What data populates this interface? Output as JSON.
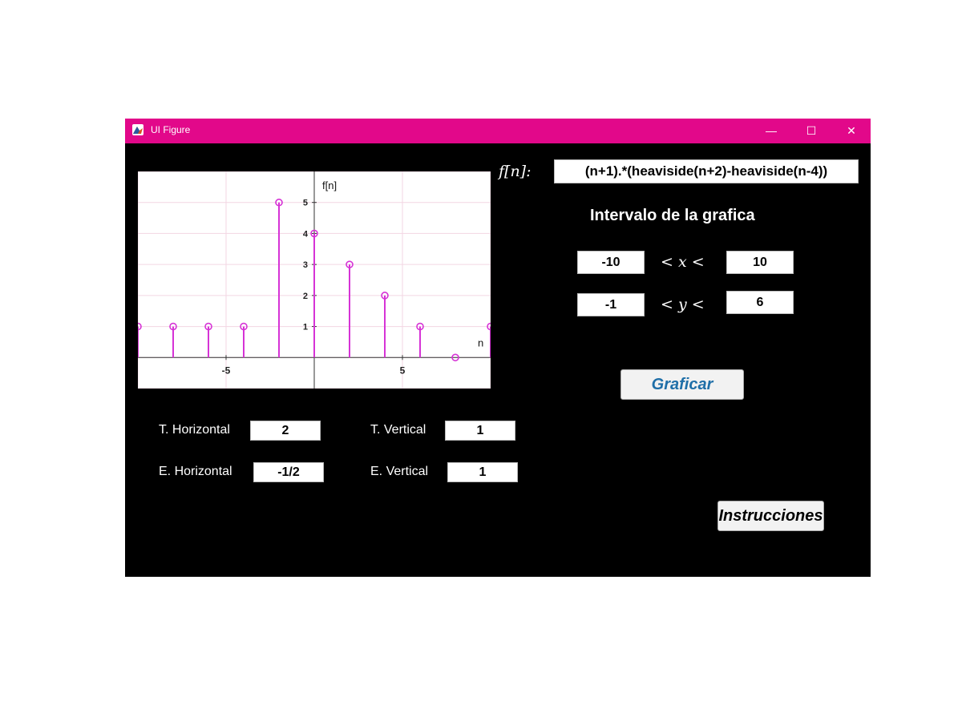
{
  "window": {
    "title": "UI Figure",
    "controls": {
      "minimize": "—",
      "maximize": "☐",
      "close": "✕"
    },
    "accent_color": "#e2088a"
  },
  "function": {
    "label": "f[n]:",
    "expression": "(n+1).*(heaviside(n+2)-heaviside(n-4))"
  },
  "interval": {
    "title": "Intervalo de la grafica",
    "x_min": "-10",
    "x_label": "< x <",
    "x_max": "10",
    "y_min": "-1",
    "y_label": "< y <",
    "y_max": "6"
  },
  "graph_button": "Graficar",
  "instructions_button": "Instrucciones",
  "transforms": {
    "t_horizontal_label": "T. Horizontal",
    "t_horizontal_value": "2",
    "t_vertical_label": "T. Vertical",
    "t_vertical_value": "1",
    "e_horizontal_label": "E. Horizontal",
    "e_horizontal_value": "-1/2",
    "e_vertical_label": "E. Vertical",
    "e_vertical_value": "1"
  },
  "chart_data": {
    "type": "stem",
    "xlabel": "n",
    "ylabel": "f[n]",
    "xlim": [
      -10,
      10
    ],
    "ylim": [
      -1,
      6
    ],
    "x_ticks": [
      -5,
      5
    ],
    "y_ticks": [
      1,
      2,
      3,
      4,
      5
    ],
    "grid": true,
    "color": "#d633d6",
    "points": [
      {
        "x": -10,
        "y": 1
      },
      {
        "x": -8,
        "y": 1
      },
      {
        "x": -6,
        "y": 1
      },
      {
        "x": -4,
        "y": 1
      },
      {
        "x": -2,
        "y": 5
      },
      {
        "x": 0,
        "y": 4
      },
      {
        "x": 2,
        "y": 3
      },
      {
        "x": 4,
        "y": 2
      },
      {
        "x": 6,
        "y": 1
      },
      {
        "x": 8,
        "y": 0
      },
      {
        "x": 10,
        "y": 1
      }
    ]
  }
}
